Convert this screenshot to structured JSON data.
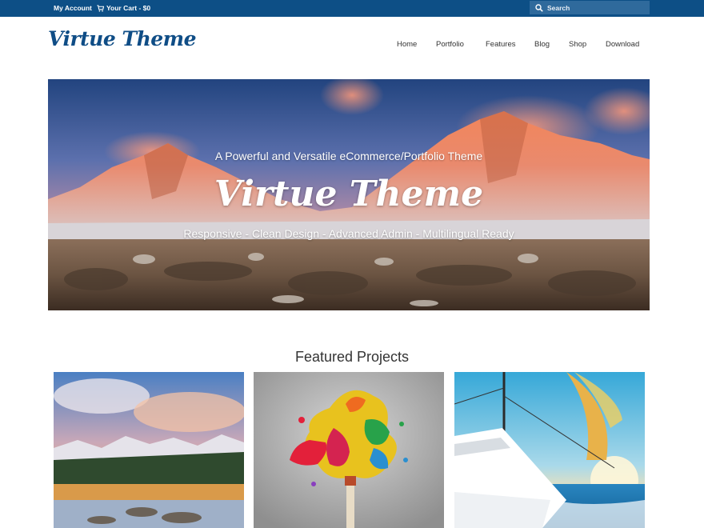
{
  "topbar": {
    "account_label": "My Account",
    "cart_label": "Your Cart - $0",
    "cart_icon": "cart-icon",
    "search_placeholder": "Search",
    "search_icon": "search-icon",
    "background_color": "#0d4f86"
  },
  "header": {
    "logo_text": "Virtue Theme",
    "logo_color": "#0f4d86",
    "nav": [
      "Home",
      "Portfolio",
      "Features",
      "Blog",
      "Shop",
      "Download"
    ]
  },
  "hero": {
    "tagline": "A Powerful and Versatile eCommerce/Portfolio Theme",
    "title": "Virtue Theme",
    "features_line": "Responsive - Clean Design - Advanced Admin - Multilingual Ready"
  },
  "featured": {
    "heading": "Featured Projects",
    "projects": [
      {
        "image": "mountain-lake-photo"
      },
      {
        "image": "paint-splash-photo"
      },
      {
        "image": "sailboat-photo"
      }
    ]
  }
}
